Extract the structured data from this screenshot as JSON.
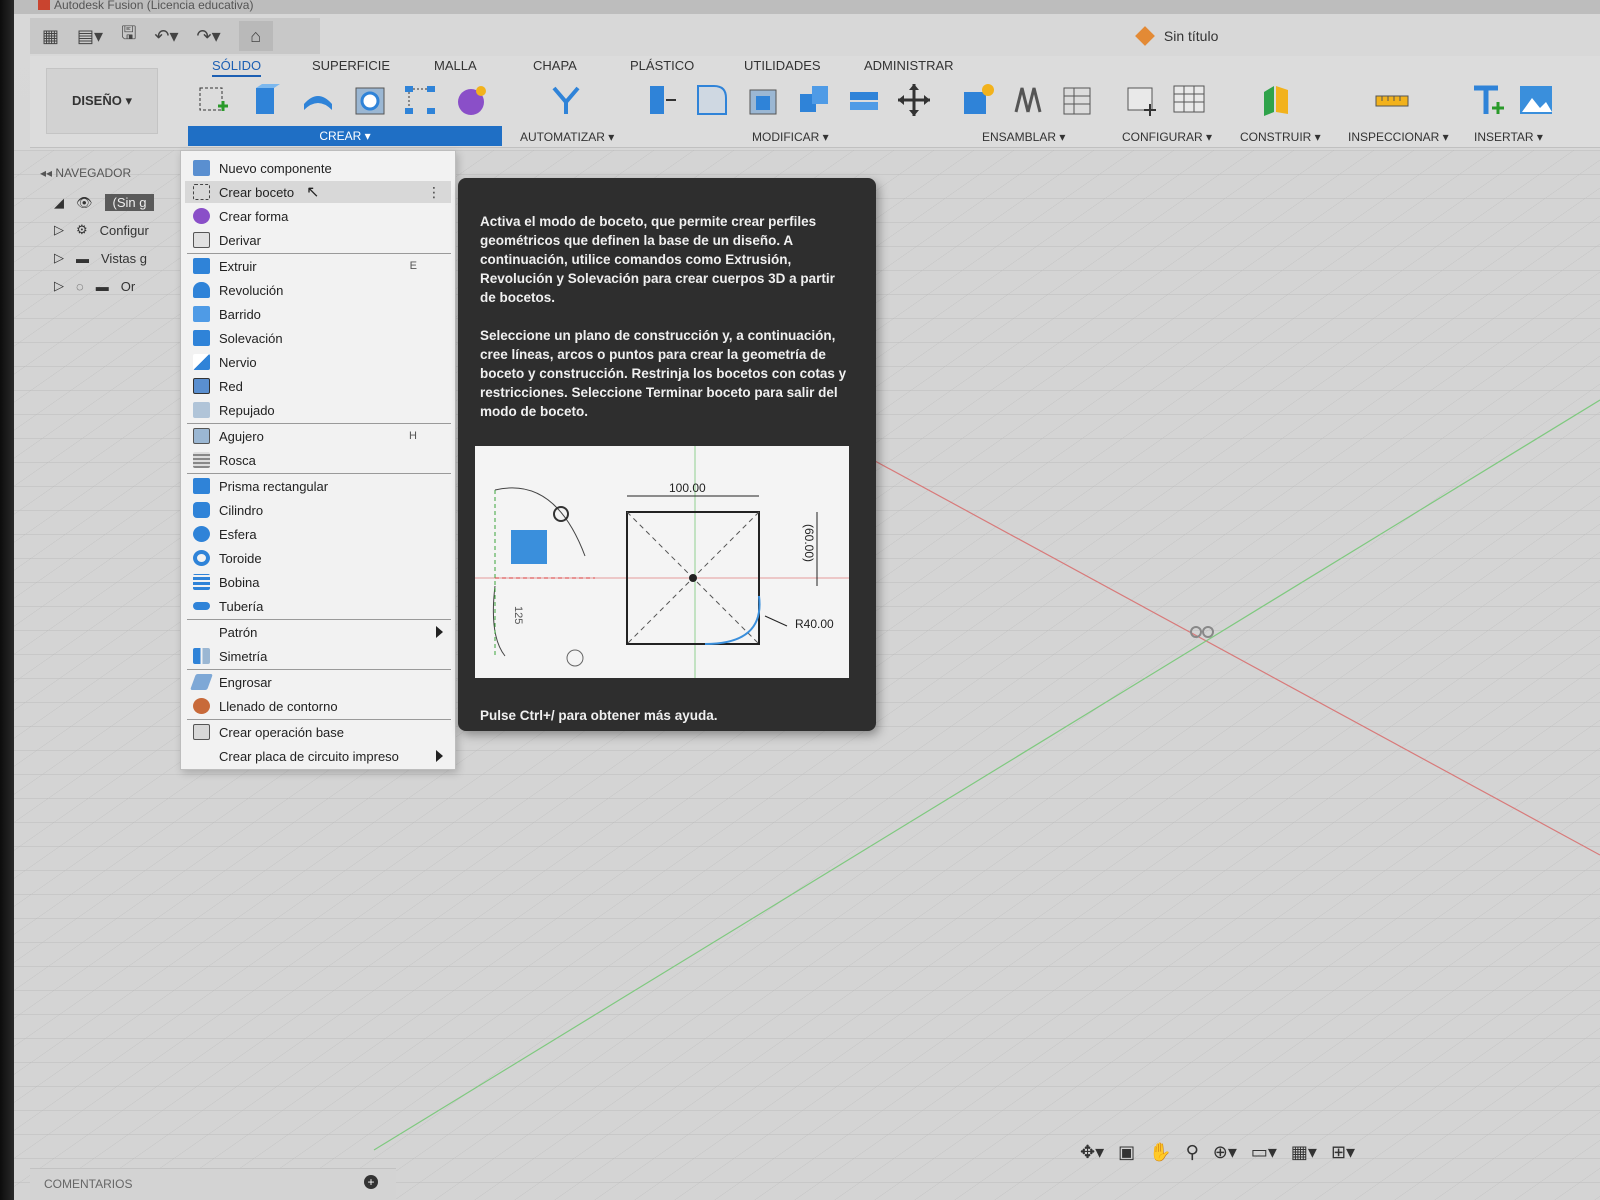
{
  "titlebar": {
    "text": "Autodesk Fusion (Licencia educativa)"
  },
  "document": {
    "title": "Sin título"
  },
  "workspace": {
    "label": "DISEÑO ▾"
  },
  "tabs": [
    "SÓLIDO",
    "SUPERFICIE",
    "MALLA",
    "CHAPA",
    "PLÁSTICO",
    "UTILIDADES",
    "ADMINISTRAR"
  ],
  "groups": {
    "crear": "CREAR ▾",
    "automatizar": "AUTOMATIZAR ▾",
    "modificar": "MODIFICAR ▾",
    "ensamblar": "ENSAMBLAR ▾",
    "configurar": "CONFIGURAR ▾",
    "construir": "CONSTRUIR ▾",
    "inspeccionar": "INSPECCIONAR ▾",
    "insertar": "INSERTAR ▾"
  },
  "navigator": {
    "title": "NAVEGADOR",
    "rows": [
      "(Sin g",
      "Configur",
      "Vistas g",
      "Or"
    ]
  },
  "menu": {
    "items": [
      {
        "label": "Nuevo componente",
        "shortcut": ""
      },
      {
        "label": "Crear boceto",
        "shortcut": ""
      },
      {
        "label": "Crear forma",
        "shortcut": ""
      },
      {
        "label": "Derivar",
        "shortcut": ""
      },
      {
        "label": "Extruir",
        "shortcut": "E"
      },
      {
        "label": "Revolución",
        "shortcut": ""
      },
      {
        "label": "Barrido",
        "shortcut": ""
      },
      {
        "label": "Solevación",
        "shortcut": ""
      },
      {
        "label": "Nervio",
        "shortcut": ""
      },
      {
        "label": "Red",
        "shortcut": ""
      },
      {
        "label": "Repujado",
        "shortcut": ""
      },
      {
        "label": "Agujero",
        "shortcut": "H"
      },
      {
        "label": "Rosca",
        "shortcut": ""
      },
      {
        "label": "Prisma rectangular",
        "shortcut": ""
      },
      {
        "label": "Cilindro",
        "shortcut": ""
      },
      {
        "label": "Esfera",
        "shortcut": ""
      },
      {
        "label": "Toroide",
        "shortcut": ""
      },
      {
        "label": "Bobina",
        "shortcut": ""
      },
      {
        "label": "Tubería",
        "shortcut": ""
      },
      {
        "label": "Patrón",
        "shortcut": ""
      },
      {
        "label": "Simetría",
        "shortcut": ""
      },
      {
        "label": "Engrosar",
        "shortcut": ""
      },
      {
        "label": "Llenado de contorno",
        "shortcut": ""
      },
      {
        "label": "Crear operación base",
        "shortcut": ""
      },
      {
        "label": "Crear placa de circuito impreso",
        "shortcut": ""
      }
    ]
  },
  "tooltip": {
    "para1": "Activa el modo de boceto, que permite crear perfiles geométricos que definen la base de un diseño. A continuación, utilice comandos como Extrusión, Revolución y Solevación para crear cuerpos 3D a partir de bocetos.",
    "para2": "Seleccione un plano de construcción y, a continuación, cree líneas, arcos o puntos para crear la geometría de boceto y construcción. Restrinja los bocetos con cotas y restricciones. Seleccione Terminar boceto para salir del modo de boceto.",
    "footer": "Pulse Ctrl+/ para obtener más ayuda.",
    "dims": {
      "width": "100.00",
      "height": "(60.00)",
      "radius": "R40.00",
      "side": "125"
    }
  },
  "comments": {
    "label": "COMENTARIOS"
  },
  "colors": {
    "accent": "#1f6fc5",
    "tooltip_bg": "#2e2e2e",
    "axis_red": "#d87a7a",
    "axis_green": "#7fc97f"
  }
}
